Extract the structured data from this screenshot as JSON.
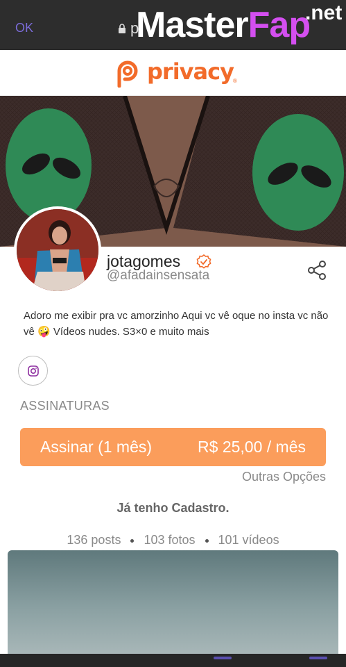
{
  "browser": {
    "ok_label": "OK",
    "url": "p"
  },
  "watermark": {
    "master": "Master",
    "fap": "Fap",
    "net": ".net"
  },
  "brand": {
    "name": "privacy",
    "registered": "®",
    "color": "#f26b2a"
  },
  "profile": {
    "username": "jotagomes",
    "handle": "@afadainsensata",
    "verified": true,
    "bio": "Adoro me exibir pra vc amorzinho Aqui vc vê oque no insta vc não vê 🤪 Vídeos nudes. S3×0 e muito mais"
  },
  "social": {
    "instagram_icon": "instagram-icon"
  },
  "subscriptions": {
    "title": "ASSINATURAS",
    "plan_label": "Assinar (1 mês)",
    "price_label": "R$ 25,00 / mês",
    "accent": "#fb9d5b",
    "other_options": "Outras Opções"
  },
  "account": {
    "have_account": "Já tenho Cadastro."
  },
  "stats": {
    "posts": "136 posts",
    "photos": "103 fotos",
    "videos": "101 vídeos"
  }
}
